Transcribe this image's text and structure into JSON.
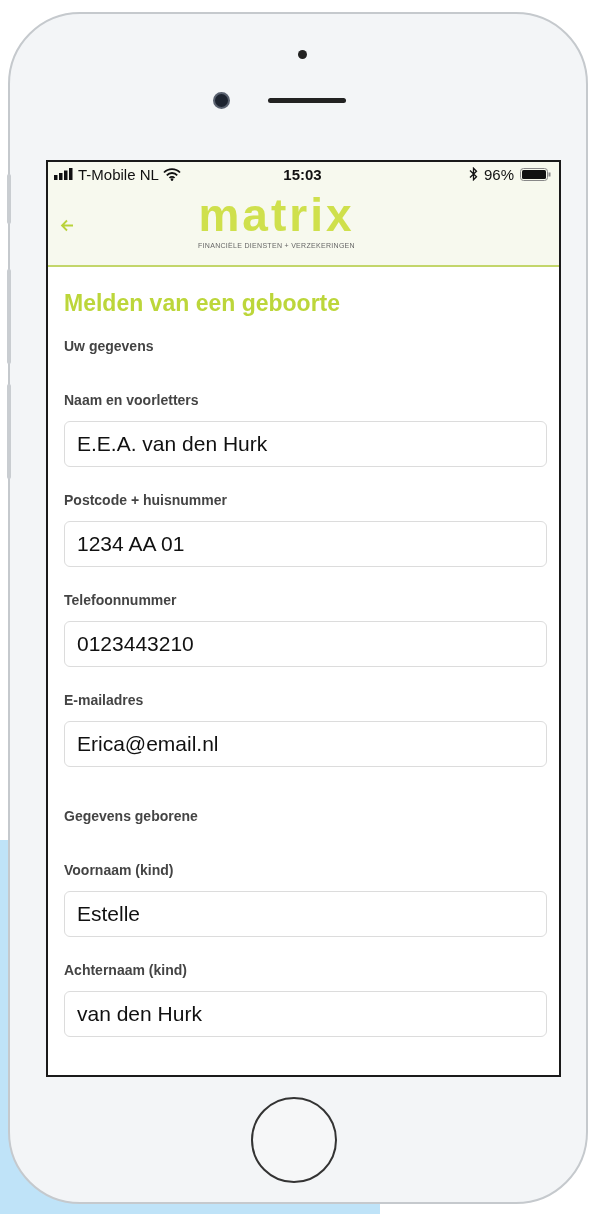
{
  "status_bar": {
    "carrier": "T-Mobile NL",
    "time": "15:03",
    "battery": "96%"
  },
  "header": {
    "logo": "matrix",
    "tagline": "FINANCIËLE DIENSTEN + VERZEKERINGEN"
  },
  "title": "Melden van een geboorte",
  "sections": [
    {
      "heading": "Uw gegevens",
      "fields": [
        {
          "label": "Naam en voorletters",
          "value": "E.E.A. van den Hurk"
        },
        {
          "label": "Postcode + huisnummer",
          "value": "1234 AA 01"
        },
        {
          "label": "Telefoonnummer",
          "value": "0123443210"
        },
        {
          "label": "E-mailadres",
          "value": "Erica@email.nl"
        }
      ]
    },
    {
      "heading": "Gegevens geborene",
      "fields": [
        {
          "label": "Voornaam (kind)",
          "value": "Estelle"
        },
        {
          "label": "Achternaam (kind)",
          "value": "van den Hurk"
        }
      ]
    }
  ]
}
